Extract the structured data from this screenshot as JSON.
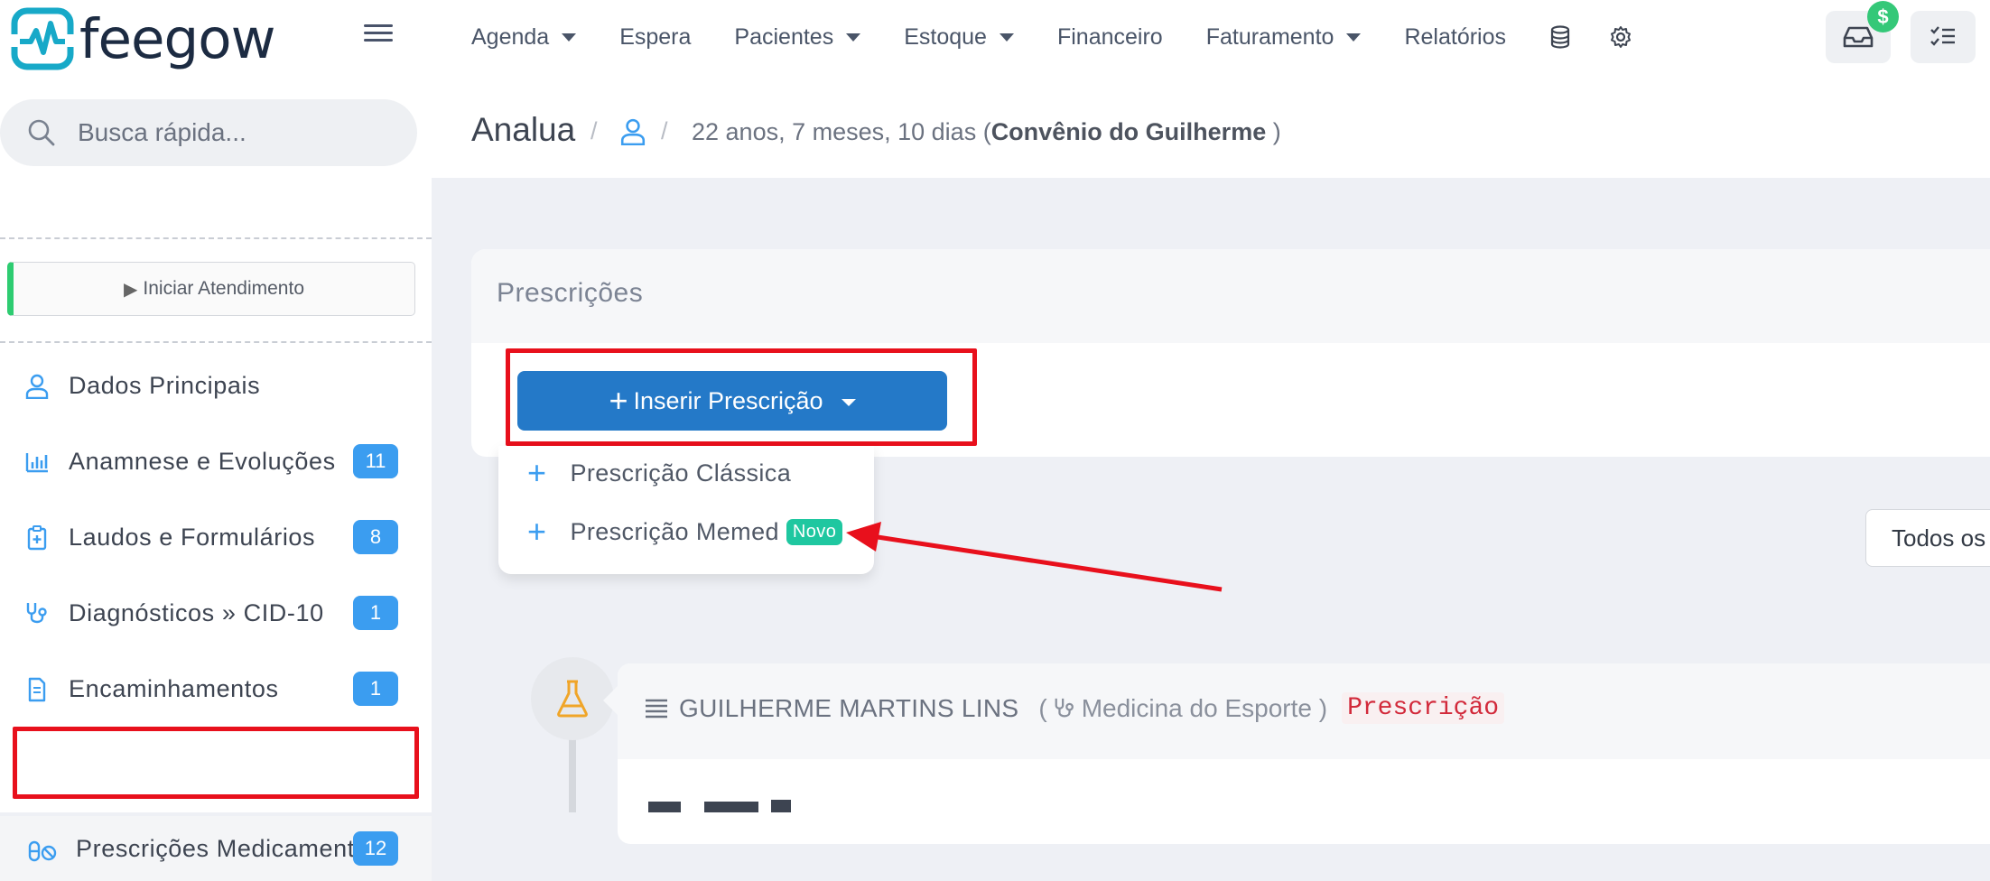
{
  "brand": {
    "name": "feegow",
    "color": "#1c2b42",
    "accent": "#17a9c8"
  },
  "nav": {
    "items": [
      {
        "label": "Agenda",
        "dropdown": true
      },
      {
        "label": "Espera",
        "dropdown": false
      },
      {
        "label": "Pacientes",
        "dropdown": true
      },
      {
        "label": "Estoque",
        "dropdown": true
      },
      {
        "label": "Financeiro",
        "dropdown": false
      },
      {
        "label": "Faturamento",
        "dropdown": true
      },
      {
        "label": "Relatórios",
        "dropdown": false
      }
    ],
    "icons": [
      "database-icon",
      "gear-icon"
    ],
    "inbox_badge": "$"
  },
  "sidebar": {
    "search_placeholder": "Busca rápida...",
    "start_label": "Iniciar Atendimento",
    "items": [
      {
        "label": "Dados Principais",
        "icon": "user-icon",
        "badge": ""
      },
      {
        "label": "Anamnese e Evoluções",
        "icon": "bar-chart-icon",
        "badge": "11"
      },
      {
        "label": "Laudos e Formulários",
        "icon": "clipboard-plus-icon",
        "badge": "8"
      },
      {
        "label": "Diagnósticos » CID-10",
        "icon": "stethoscope-icon",
        "badge": "1"
      },
      {
        "label": "Encaminhamentos",
        "icon": "document-icon",
        "badge": "1"
      },
      {
        "label": "Prescrições Medicamentos",
        "icon": "pills-icon",
        "badge": "12"
      }
    ]
  },
  "patient": {
    "name": "Analua",
    "age": "22 anos, 7 meses, 10 dias (",
    "insurance": "Convênio do Guilherme",
    "close": " )"
  },
  "prescriptions": {
    "title": "Prescrições",
    "insert_label": "Inserir Prescrição",
    "menu": [
      {
        "label": "Prescrição Clássica",
        "badge": ""
      },
      {
        "label": "Prescrição Memed",
        "badge": "Novo"
      }
    ],
    "filter_label": "Todos os"
  },
  "entry": {
    "doctor": "GUILHERME MARTINS LINS",
    "open_paren": "(",
    "specialty": "Medicina do Esporte )",
    "tag": "Prescrição"
  },
  "colors": {
    "highlight": "#e8101c",
    "primary": "#2479c8",
    "badge": "#3b9df0",
    "novo": "#1fc7a0"
  }
}
